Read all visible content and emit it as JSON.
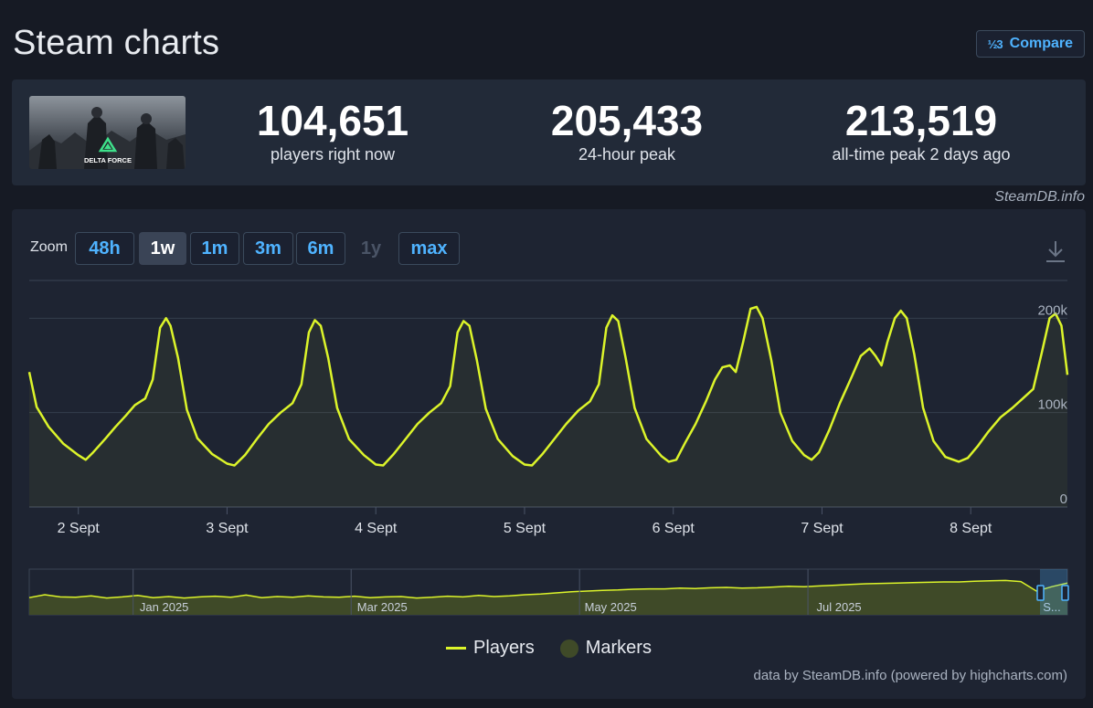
{
  "page": {
    "title": "Steam charts",
    "compare_label": "Compare",
    "compare_icon": "½3"
  },
  "stats": [
    {
      "value": "104,651",
      "label": "players right now"
    },
    {
      "value": "205,433",
      "label": "24-hour peak"
    },
    {
      "value": "213,519",
      "label": "all-time peak 2 days ago"
    }
  ],
  "thumbnail": {
    "caption": "DELTA FORCE"
  },
  "credit_top": "SteamDB.info",
  "zoom": {
    "label": "Zoom",
    "buttons": [
      {
        "label": "48h",
        "state": "normal"
      },
      {
        "label": "1w",
        "state": "active"
      },
      {
        "label": "1m",
        "state": "normal"
      },
      {
        "label": "3m",
        "state": "normal"
      },
      {
        "label": "6m",
        "state": "normal"
      },
      {
        "label": "1y",
        "state": "disabled"
      },
      {
        "label": "max",
        "state": "normal"
      }
    ]
  },
  "legend": {
    "players": "Players",
    "markers": "Markers"
  },
  "credit_bottom": "data by SteamDB.info (powered by highcharts.com)",
  "colors": {
    "line": "#dcf42a",
    "marker": "#3f4a28",
    "accent": "#4fb3ff"
  },
  "chart_data": {
    "type": "line",
    "series_name": "Players",
    "x_tick_labels": [
      "2 Sept",
      "3 Sept",
      "4 Sept",
      "5 Sept",
      "6 Sept",
      "7 Sept",
      "8 Sept"
    ],
    "y_tick_labels": [
      "0",
      "100k",
      "200k"
    ],
    "ylim": [
      0,
      240000
    ],
    "x_range_days": [
      1.67,
      8.65
    ],
    "grid": true,
    "legend_position": "bottom",
    "points": [
      [
        1.67,
        143000
      ],
      [
        1.72,
        106000
      ],
      [
        1.8,
        85000
      ],
      [
        1.9,
        67000
      ],
      [
        2.0,
        55000
      ],
      [
        2.05,
        50000
      ],
      [
        2.1,
        58000
      ],
      [
        2.18,
        72000
      ],
      [
        2.25,
        85000
      ],
      [
        2.32,
        97000
      ],
      [
        2.38,
        108000
      ],
      [
        2.45,
        115000
      ],
      [
        2.5,
        135000
      ],
      [
        2.55,
        190000
      ],
      [
        2.59,
        200000
      ],
      [
        2.62,
        192000
      ],
      [
        2.67,
        158000
      ],
      [
        2.73,
        103000
      ],
      [
        2.8,
        73000
      ],
      [
        2.9,
        56000
      ],
      [
        3.0,
        46000
      ],
      [
        3.05,
        44000
      ],
      [
        3.12,
        55000
      ],
      [
        3.2,
        72000
      ],
      [
        3.28,
        88000
      ],
      [
        3.36,
        100000
      ],
      [
        3.44,
        110000
      ],
      [
        3.5,
        130000
      ],
      [
        3.55,
        185000
      ],
      [
        3.59,
        198000
      ],
      [
        3.63,
        192000
      ],
      [
        3.68,
        158000
      ],
      [
        3.74,
        105000
      ],
      [
        3.82,
        72000
      ],
      [
        3.92,
        55000
      ],
      [
        4.0,
        45000
      ],
      [
        4.05,
        44000
      ],
      [
        4.12,
        56000
      ],
      [
        4.2,
        72000
      ],
      [
        4.28,
        88000
      ],
      [
        4.36,
        100000
      ],
      [
        4.44,
        110000
      ],
      [
        4.5,
        128000
      ],
      [
        4.55,
        185000
      ],
      [
        4.59,
        197000
      ],
      [
        4.63,
        192000
      ],
      [
        4.68,
        155000
      ],
      [
        4.74,
        104000
      ],
      [
        4.82,
        72000
      ],
      [
        4.92,
        54000
      ],
      [
        5.0,
        45000
      ],
      [
        5.05,
        44000
      ],
      [
        5.12,
        56000
      ],
      [
        5.2,
        72000
      ],
      [
        5.28,
        88000
      ],
      [
        5.36,
        102000
      ],
      [
        5.44,
        112000
      ],
      [
        5.5,
        130000
      ],
      [
        5.55,
        190000
      ],
      [
        5.59,
        203000
      ],
      [
        5.63,
        197000
      ],
      [
        5.68,
        158000
      ],
      [
        5.74,
        105000
      ],
      [
        5.82,
        72000
      ],
      [
        5.92,
        54000
      ],
      [
        5.97,
        48000
      ],
      [
        6.02,
        50000
      ],
      [
        6.08,
        68000
      ],
      [
        6.15,
        88000
      ],
      [
        6.22,
        112000
      ],
      [
        6.28,
        135000
      ],
      [
        6.33,
        148000
      ],
      [
        6.38,
        150000
      ],
      [
        6.42,
        143000
      ],
      [
        6.47,
        175000
      ],
      [
        6.52,
        210000
      ],
      [
        6.56,
        212000
      ],
      [
        6.6,
        200000
      ],
      [
        6.66,
        155000
      ],
      [
        6.72,
        100000
      ],
      [
        6.8,
        70000
      ],
      [
        6.88,
        55000
      ],
      [
        6.93,
        50000
      ],
      [
        6.98,
        58000
      ],
      [
        7.05,
        82000
      ],
      [
        7.12,
        110000
      ],
      [
        7.2,
        138000
      ],
      [
        7.26,
        160000
      ],
      [
        7.32,
        168000
      ],
      [
        7.36,
        160000
      ],
      [
        7.4,
        150000
      ],
      [
        7.44,
        175000
      ],
      [
        7.49,
        200000
      ],
      [
        7.53,
        208000
      ],
      [
        7.57,
        200000
      ],
      [
        7.62,
        162000
      ],
      [
        7.68,
        105000
      ],
      [
        7.75,
        70000
      ],
      [
        7.83,
        53000
      ],
      [
        7.92,
        48000
      ],
      [
        7.98,
        52000
      ],
      [
        8.05,
        65000
      ],
      [
        8.12,
        80000
      ],
      [
        8.2,
        95000
      ],
      [
        8.28,
        105000
      ],
      [
        8.35,
        115000
      ],
      [
        8.42,
        125000
      ],
      [
        8.48,
        165000
      ],
      [
        8.53,
        200000
      ],
      [
        8.57,
        205000
      ],
      [
        8.61,
        192000
      ],
      [
        8.65,
        140000
      ]
    ],
    "navigator": {
      "labels": [
        "Jan 2025",
        "Mar 2025",
        "May 2025",
        "Jul 2025",
        "S..."
      ],
      "series": [
        0.42,
        0.5,
        0.44,
        0.43,
        0.47,
        0.41,
        0.44,
        0.48,
        0.42,
        0.45,
        0.41,
        0.44,
        0.46,
        0.43,
        0.49,
        0.42,
        0.45,
        0.43,
        0.47,
        0.44,
        0.43,
        0.46,
        0.42,
        0.44,
        0.45,
        0.41,
        0.43,
        0.46,
        0.44,
        0.48,
        0.45,
        0.47,
        0.5,
        0.52,
        0.55,
        0.58,
        0.6,
        0.62,
        0.63,
        0.65,
        0.66,
        0.66,
        0.68,
        0.67,
        0.69,
        0.7,
        0.68,
        0.69,
        0.71,
        0.73,
        0.72,
        0.74,
        0.76,
        0.78,
        0.8,
        0.81,
        0.82,
        0.83,
        0.84,
        0.85,
        0.85,
        0.87,
        0.88,
        0.89,
        0.86,
        0.6,
        0.72,
        0.82
      ]
    }
  }
}
